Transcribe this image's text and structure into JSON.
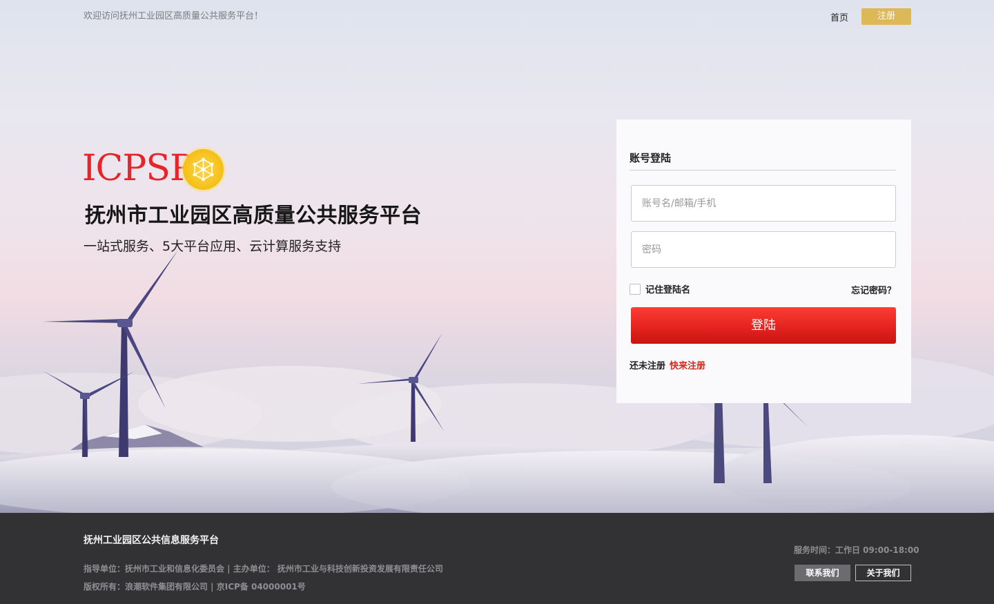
{
  "topbar": {
    "welcome": "欢迎访问抚州工业园区高质量公共服务平台！",
    "home_label": "首页",
    "register_label": "注册"
  },
  "brand": {
    "logo_text": "ICPSP",
    "title": "抚州市工业园区高质量公共服务平台",
    "subtitle": "一站式服务、5大平台应用、云计算服务支持"
  },
  "login": {
    "title": "账号登陆",
    "account_placeholder": "账号名/邮箱/手机",
    "password_placeholder": "密码",
    "remember_label": "记住登陆名",
    "forgot_label": "忘记密码？",
    "submit_label": "登陆",
    "not_registered": "还未注册",
    "quick_register": "快来注册"
  },
  "footer": {
    "title": "抚州工业园区公共信息服务平台",
    "line1": "指导单位：抚州市工业和信息化委员会 | 主办单位： 抚州市工业与科技创新投资发展有限责任公司",
    "line2": "版权所有：浪潮软件集团有限公司 | 京ICP备 04000001号",
    "service_time": "服务时间：工作日  09:00-18:00",
    "contact_label": "联系我们",
    "about_label": "关于我们"
  },
  "colors": {
    "brand_red": "#e4262a",
    "register_gold": "#dcb857",
    "login_button": "#e5231f",
    "footer_bg": "#323234"
  }
}
